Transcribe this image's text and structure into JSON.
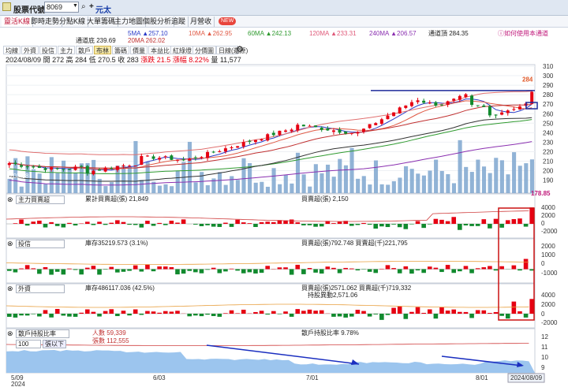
{
  "header": {
    "title": "股票代號",
    "stock_code": "8069",
    "currency": "元太"
  },
  "tabs": [
    "靈活K線",
    "即時走勢",
    "分點K線",
    "大單籌碼",
    "主力地圖",
    "個股分析",
    "追蹤",
    "月營收"
  ],
  "new_badge": "NEW",
  "ma": {
    "ma5": "5MA ▲257.10",
    "ma10": "10MA ▲262.95",
    "ma60": "60MA ▲242.13",
    "ma120": "120MA ▲233.31",
    "ma240": "240MA ▲206.57",
    "channel_top": "通道頂 284.35",
    "channel_bottom": "通道底 239.69",
    "ma20": "20MA 262.02",
    "hint": "ⓘ如何使用本通道"
  },
  "toolbar": [
    "均線",
    "外資",
    "投信",
    "主力",
    "散戶",
    "布林",
    "籌碼",
    "價量",
    "本益比",
    "紅綠燈",
    "分價圖"
  ],
  "toolbar_active_index": 5,
  "period": "日線(還原)",
  "info": {
    "date": "2024/08/09",
    "open": "開 272",
    "high": "高 284",
    "low": "低 270.5",
    "close": "收 283",
    "chg": "漲跌 21.5",
    "pct": "漲幅 8.22%",
    "vol": "量 11,577"
  },
  "price_label": "284",
  "price_ticks": [
    "310",
    "300",
    "290",
    "280",
    "270",
    "260",
    "250",
    "240",
    "230",
    "220",
    "210",
    "200",
    "190"
  ],
  "left_value": "203.58",
  "x_ticks": [
    "5/09",
    "6/03",
    "7/01",
    "8/01",
    "2024/08/09"
  ],
  "year_label": "2024",
  "panels": {
    "main": {
      "name": "主力買賣超",
      "label1": "累計買賣超(張) 21,849",
      "label2": "買賣超(張) 2,150",
      "value": "178.85",
      "ticks": [
        "4000",
        "2000",
        "0",
        "-2000"
      ]
    },
    "trust": {
      "name": "投信",
      "label1": "庫存35219.573 (3.1%)",
      "label2": "買賣超(張)792.748 買賣超(千)221,795",
      "ticks": [
        "2000",
        "1000",
        "0",
        "-1000"
      ]
    },
    "foreign": {
      "name": "外資",
      "label1": "庫存486117.036 (42.5%)",
      "label2": "買賣超(張)2571.062 買賣超(千)719,332",
      "label3": "持股異動2,571.06",
      "ticks": [
        "4000",
        "2000",
        "0",
        "-2000"
      ]
    },
    "retail": {
      "name": "散戶持股比率",
      "count": "人數 59,339",
      "lots": "張數 112,555",
      "ratio": "散戶持股比率 9.78%",
      "select_value": "100",
      "select_mode": "張以下",
      "ticks": [
        "12",
        "11",
        "10",
        "9"
      ]
    }
  },
  "colors": {
    "up": "#e60012",
    "down": "#118a2e",
    "vol": "#7ea6cf",
    "ma5": "#2c3cc8",
    "ma10": "#e05a45",
    "ma20": "#c03030",
    "ma60": "#2f9a2f",
    "ma240": "#8a2fb0",
    "channel": "#1c2a9a",
    "box": "#cc1111",
    "arrow": "#1b2fc0"
  }
}
